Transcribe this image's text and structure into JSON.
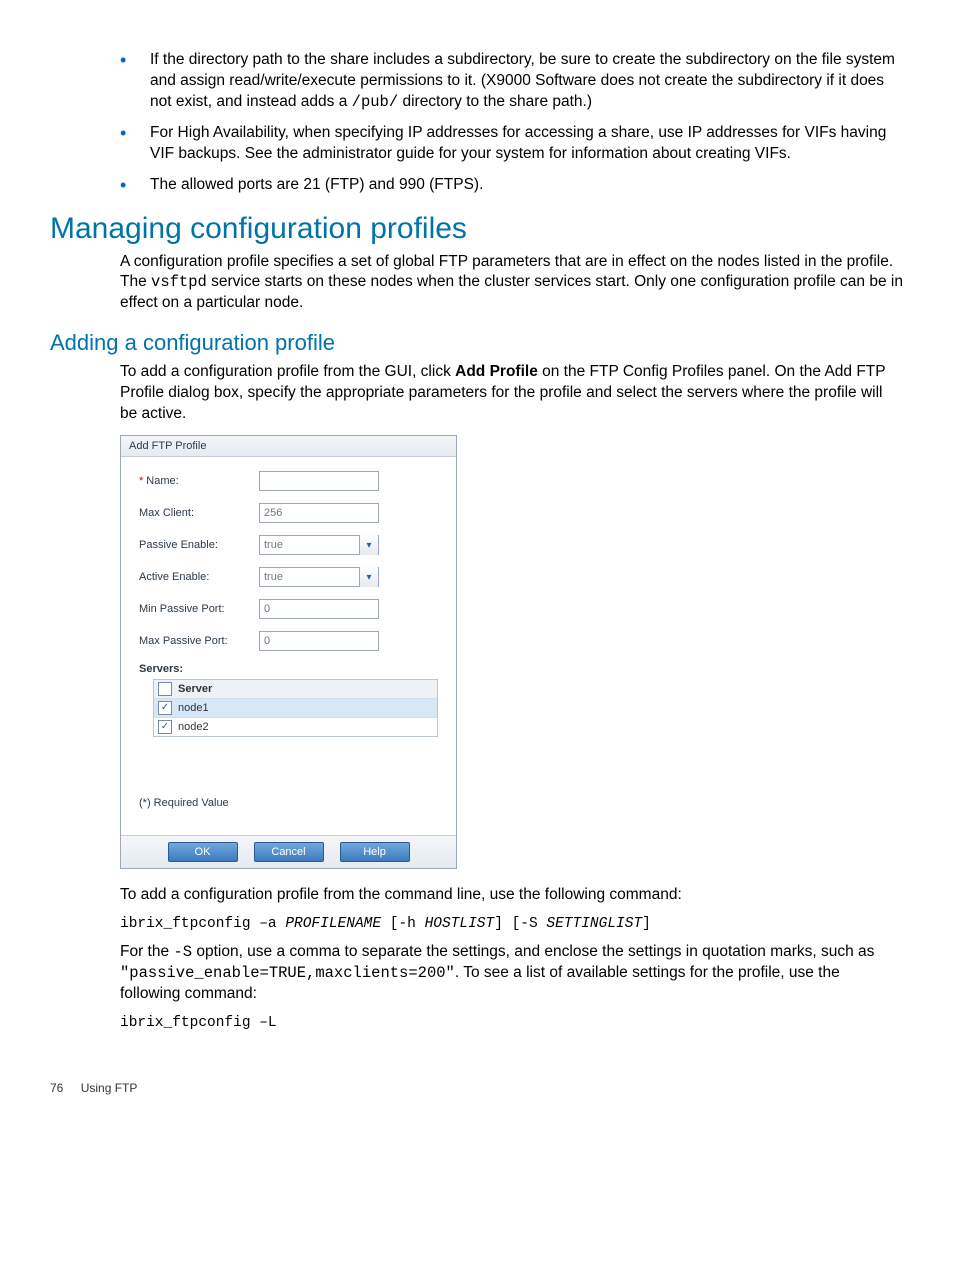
{
  "bullets": [
    {
      "pre": "If the directory path to the share includes a subdirectory, be sure to create the subdirectory on the file system and assign read/write/execute permissions to it. (X9000 Software does not create the subdirectory if it does not exist, and instead adds a ",
      "code": "/pub/",
      "post": " directory to the share path.)"
    },
    {
      "pre": "For High Availability, when specifying IP addresses for accessing a share, use IP addresses for VIFs having VIF backups. See the administrator guide for your system for information about creating VIFs.",
      "code": "",
      "post": ""
    },
    {
      "pre": "The allowed ports are 21 (FTP) and 990 (FTPS).",
      "code": "",
      "post": ""
    }
  ],
  "headings": {
    "h1": "Managing configuration profiles",
    "h2": "Adding a configuration profile"
  },
  "para1": {
    "pre": "A configuration profile specifies a set of global FTP parameters that are in effect on the nodes listed in the profile. The ",
    "code": "vsftpd",
    "post": " service starts on these nodes when the cluster services start. Only one configuration profile can be in effect on a particular node."
  },
  "para2": {
    "pre": "To add a configuration profile from the GUI, click ",
    "bold": "Add Profile",
    "post": " on the FTP Config Profiles panel. On the Add FTP Profile dialog box, specify the appropriate parameters for the profile and select the servers where the profile will be active."
  },
  "dialog": {
    "title": "Add FTP Profile",
    "fields": {
      "name": {
        "label": "Name:",
        "value": "",
        "required": true
      },
      "maxClient": {
        "label": "Max Client:",
        "value": "256"
      },
      "passiveEnable": {
        "label": "Passive Enable:",
        "value": "true"
      },
      "activeEnable": {
        "label": "Active Enable:",
        "value": "true"
      },
      "minPassivePort": {
        "label": "Min Passive Port:",
        "value": "0"
      },
      "maxPassivePort": {
        "label": "Max Passive Port:",
        "value": "0"
      }
    },
    "serversLabel": "Servers:",
    "serversHeader": "Server",
    "servers": [
      {
        "name": "node1",
        "checked": true
      },
      {
        "name": "node2",
        "checked": true
      }
    ],
    "reqNote": "(*) Required Value",
    "buttons": {
      "ok": "OK",
      "cancel": "Cancel",
      "help": "Help"
    }
  },
  "afterDialog": {
    "p1": "To add a configuration profile from the command line, use the following command:",
    "cmd1": {
      "a": "ibrix_ftpconfig –a ",
      "b": "PROFILENAME",
      "c": " [-h ",
      "d": "HOSTLIST",
      "e": "] [-S ",
      "f": "SETTINGLIST",
      "g": "]"
    },
    "p2": {
      "a": "For the ",
      "b": "-S",
      "c": " option, use a comma to separate the settings, and enclose the settings in quotation marks, such as ",
      "d": "\"passive_enable=TRUE,maxclients=200\"",
      "e": ". To see a list of available settings for the profile, use the following command:"
    },
    "cmd2": "ibrix_ftpconfig –L"
  },
  "footer": {
    "page": "76",
    "section": "Using FTP"
  }
}
